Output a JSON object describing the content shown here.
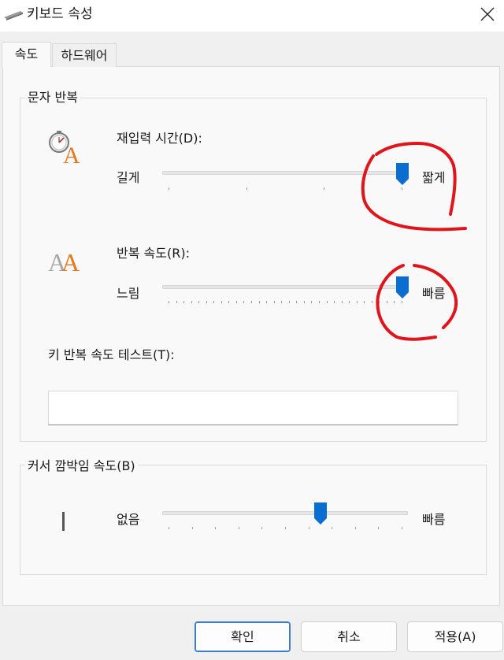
{
  "window": {
    "title": "키보드 속성"
  },
  "tabs": [
    {
      "label": "속도",
      "active": true
    },
    {
      "label": "하드웨어",
      "active": false
    }
  ],
  "character_repeat": {
    "group_label": "문자 반복",
    "repeat_delay": {
      "label": "재입력 시간(D):",
      "left_label": "길게",
      "right_label": "짧게",
      "value_fraction": 1.0,
      "tick_count": 4
    },
    "repeat_rate": {
      "label": "반복 속도(R):",
      "left_label": "느림",
      "right_label": "빠름",
      "value_fraction": 1.0,
      "tick_count": 32
    },
    "test": {
      "label": "키 반복 속도 테스트(T):",
      "value": ""
    }
  },
  "cursor_blink": {
    "group_label": "커서 깜박임 속도(B)",
    "left_label": "없음",
    "right_label": "빠름",
    "value_fraction": 0.65,
    "tick_count": 11
  },
  "buttons": {
    "ok": "확인",
    "cancel": "취소",
    "apply": "적용(A)"
  },
  "colors": {
    "accent": "#0a6ed1",
    "annotation": "#e0151b",
    "icon_orange": "#e87722"
  },
  "icons": [
    "keyboard-icon",
    "close-icon",
    "stopwatch-a-icon",
    "double-a-icon",
    "cursor-icon"
  ]
}
